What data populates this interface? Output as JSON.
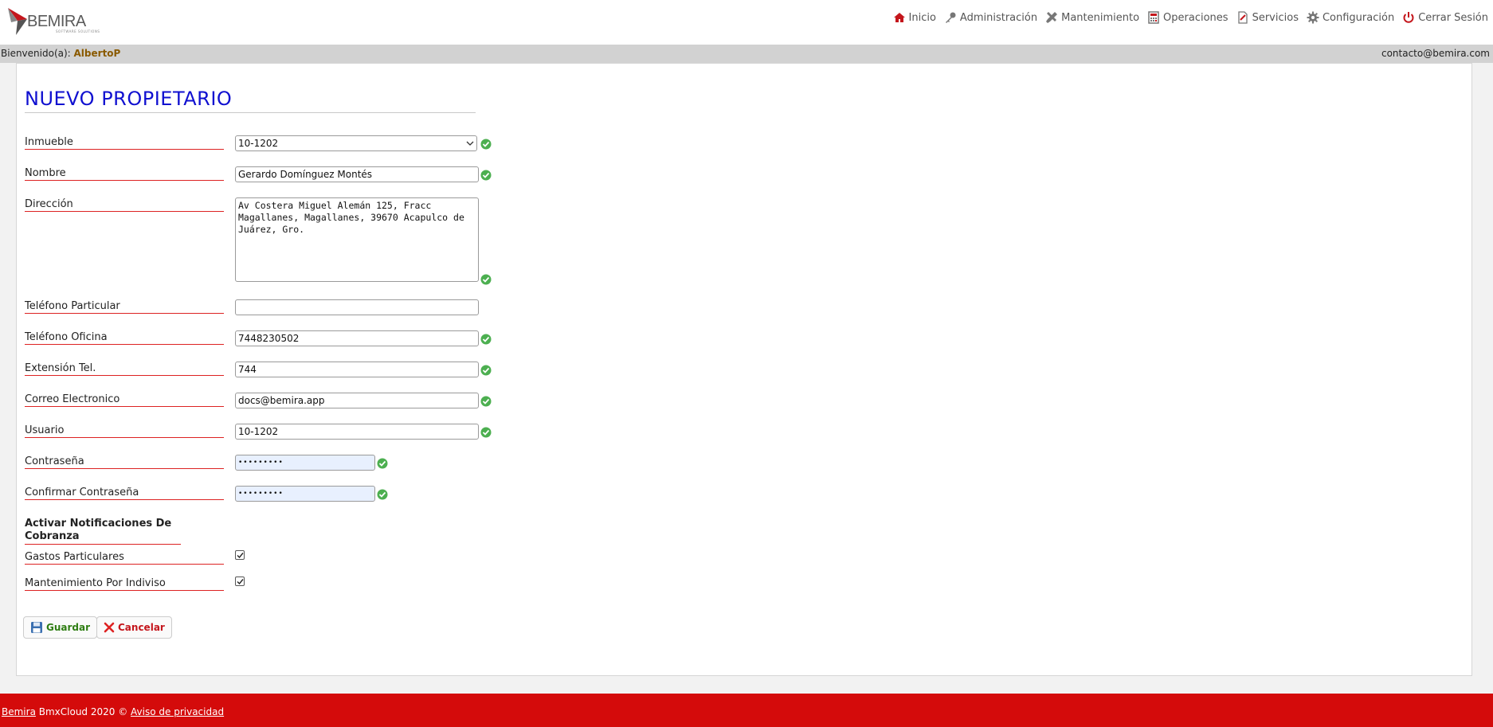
{
  "logo": {
    "brand": "BEMIRA",
    "tagline": "SOFTWARE SOLUTIONS"
  },
  "nav": [
    {
      "id": "inicio",
      "label": "Inicio",
      "icon": "home-icon"
    },
    {
      "id": "administracion",
      "label": "Administración",
      "icon": "key-icon"
    },
    {
      "id": "mantenimiento",
      "label": "Mantenimiento",
      "icon": "tools-icon"
    },
    {
      "id": "operaciones",
      "label": "Operaciones",
      "icon": "calculator-icon"
    },
    {
      "id": "servicios",
      "label": "Servicios",
      "icon": "document-icon"
    },
    {
      "id": "configuracion",
      "label": "Configuración",
      "icon": "gear-icon"
    },
    {
      "id": "cerrar",
      "label": "Cerrar Sesión",
      "icon": "power-icon"
    }
  ],
  "welcome": {
    "prefix": "Bienvenido(a): ",
    "user": "AlbertoP",
    "contact": "contacto@bemira.com"
  },
  "form": {
    "title": "NUEVO PROPIETARIO",
    "inmueble_label": "Inmueble",
    "inmueble_value": "10-1202",
    "nombre_label": "Nombre",
    "nombre_value": "Gerardo Domínguez Montés",
    "direccion_label": "Dirección",
    "direccion_value": "Av Costera Miguel Alemán 125, Fracc Magallanes, Magallanes, 39670 Acapulco de Juárez, Gro.",
    "tel_particular_label": "Teléfono Particular",
    "tel_particular_value": "",
    "tel_oficina_label": "Teléfono Oficina",
    "tel_oficina_value": "7448230502",
    "extension_label": "Extensión Tel.",
    "extension_value": "744",
    "correo_label": "Correo Electronico",
    "correo_value": "docs@bemira.app",
    "usuario_label": "Usuario",
    "usuario_value": "10-1202",
    "contrasena_label": "Contraseña",
    "contrasena_value": "•••••••••",
    "confirmar_label": "Confirmar Contraseña",
    "confirmar_value": "•••••••••",
    "notif_section": "Activar Notificaciones De Cobranza",
    "gastos_label": "Gastos Particulares",
    "gastos_checked": true,
    "mantenimiento_label": "Mantenimiento Por Indiviso",
    "mantenimiento_checked": true,
    "save_label": "Guardar",
    "cancel_label": "Cancelar"
  },
  "footer": {
    "brand": "Bemira",
    "text": " BmxCloud 2020 © ",
    "privacy": "Aviso de privacidad"
  },
  "colors": {
    "accent_red": "#d40b0b",
    "title_blue": "#1010d0",
    "valid_green": "#4caf50"
  }
}
